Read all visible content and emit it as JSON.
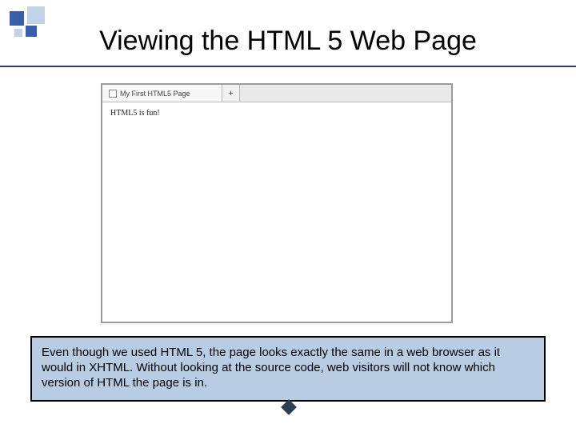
{
  "slide": {
    "title": "Viewing the HTML 5 Web Page"
  },
  "browser": {
    "tab_title": "My First HTML5 Page",
    "new_tab_label": "+",
    "body_text": "HTML5 is fun!"
  },
  "caption": {
    "text": "Even though we used HTML 5, the page looks exactly the same in a web browser as it would in XHTML.  Without looking at the source code, web visitors will not know which version of HTML the page is in."
  }
}
